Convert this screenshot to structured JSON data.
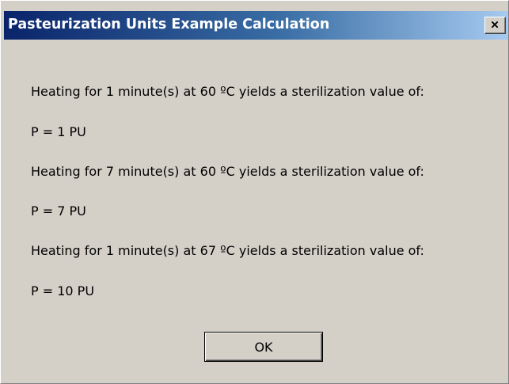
{
  "window": {
    "title": "Pasteurization Units Example Calculation",
    "close_label": "×",
    "colors": {
      "face": "#d4d0c8",
      "title_start": "#0a246a",
      "title_end": "#a6caf0"
    }
  },
  "message": {
    "lines": [
      "Heating for 1 minute(s) at 60 ºC yields a sterilization value of:",
      "P = 1 PU",
      "Heating for 7 minute(s) at 60 ºC yields a sterilization value of:",
      "P = 7 PU",
      "Heating for 1 minute(s) at 67 ºC yields a sterilization value of:",
      "P = 10 PU"
    ]
  },
  "buttons": {
    "ok_label": "OK"
  }
}
